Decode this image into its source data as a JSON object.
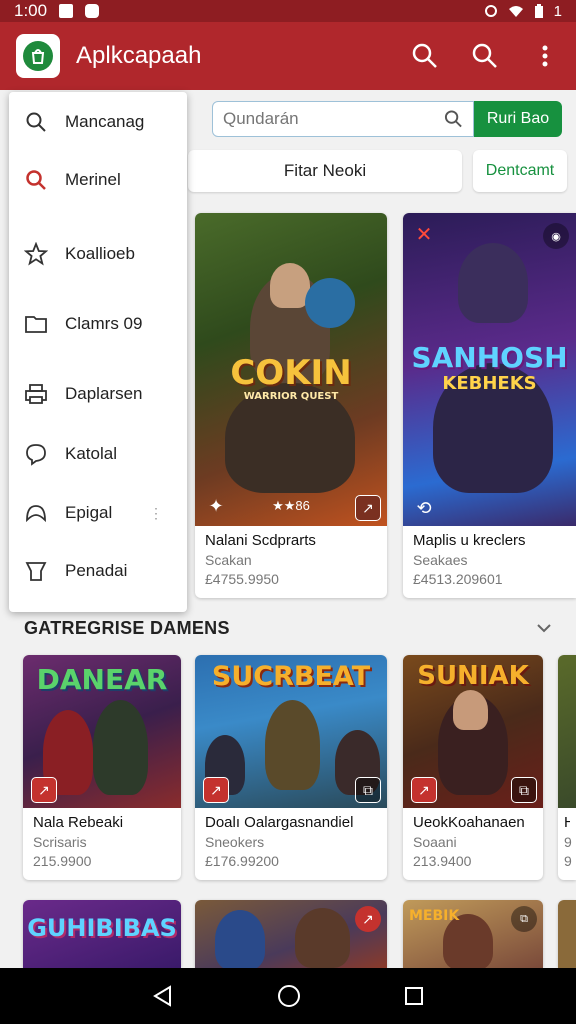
{
  "status_bar": {
    "time": "1:00",
    "signal": "1"
  },
  "app_bar": {
    "title": "Aplkcapaah",
    "accent": "#b0272c"
  },
  "search": {
    "placeholder": "Qundarán",
    "button": "Ruri Bao"
  },
  "filter": {
    "label": "Fitar Neoki",
    "download": "Dentcamt"
  },
  "drawer": {
    "items": [
      {
        "label": "Mancanag",
        "icon": "search-icon"
      },
      {
        "label": "Merinel",
        "icon": "search-icon-red"
      },
      {
        "label": "Koallioeb",
        "icon": "star-icon"
      },
      {
        "label": "Clamrs 09",
        "icon": "folder-icon"
      },
      {
        "label": "Daplarsen",
        "icon": "printer-icon"
      },
      {
        "label": "Katolal",
        "icon": "chat-icon"
      },
      {
        "label": "Epigal",
        "icon": "shield-icon",
        "more": "⋮"
      },
      {
        "label": "Penadai",
        "icon": "trash-icon"
      }
    ]
  },
  "featured": [
    {
      "art_title": "COKIN",
      "art_sub": "WARRIOR QUEST",
      "badge_text": "★★86",
      "name": "Nalani Scdprarts",
      "sub": "Scakan",
      "price": "£4755.9950"
    },
    {
      "art_title": "SANHOSH",
      "art_sub": "KEBHEKS",
      "name": "Maplis u kreclers",
      "sub": "Seakaes",
      "price": "£4513.209601"
    }
  ],
  "section": {
    "title": "GATREGRISE DAMENS"
  },
  "category_cards": [
    {
      "art_title": "DANEAR",
      "name": "Nala Rebeaki",
      "sub": "Scrisaris",
      "price": "215.9900"
    },
    {
      "art_title": "SUCRBEAT",
      "name": "Doalı Oalargasnandiel",
      "sub": "Sneokers",
      "price": "£176.99200"
    },
    {
      "art_title": "SUNIAK",
      "name": "UeokKoahanaen",
      "sub": "Soaani",
      "price": "213.9400"
    },
    {
      "art_title": "",
      "name": "H",
      "sub": "9",
      "price": "9"
    }
  ],
  "bottom_cards": [
    {
      "art_title": "GUHIBIBAS"
    },
    {
      "art_title": ""
    },
    {
      "art_title": ""
    },
    {
      "art_title": "MEBIK"
    }
  ]
}
